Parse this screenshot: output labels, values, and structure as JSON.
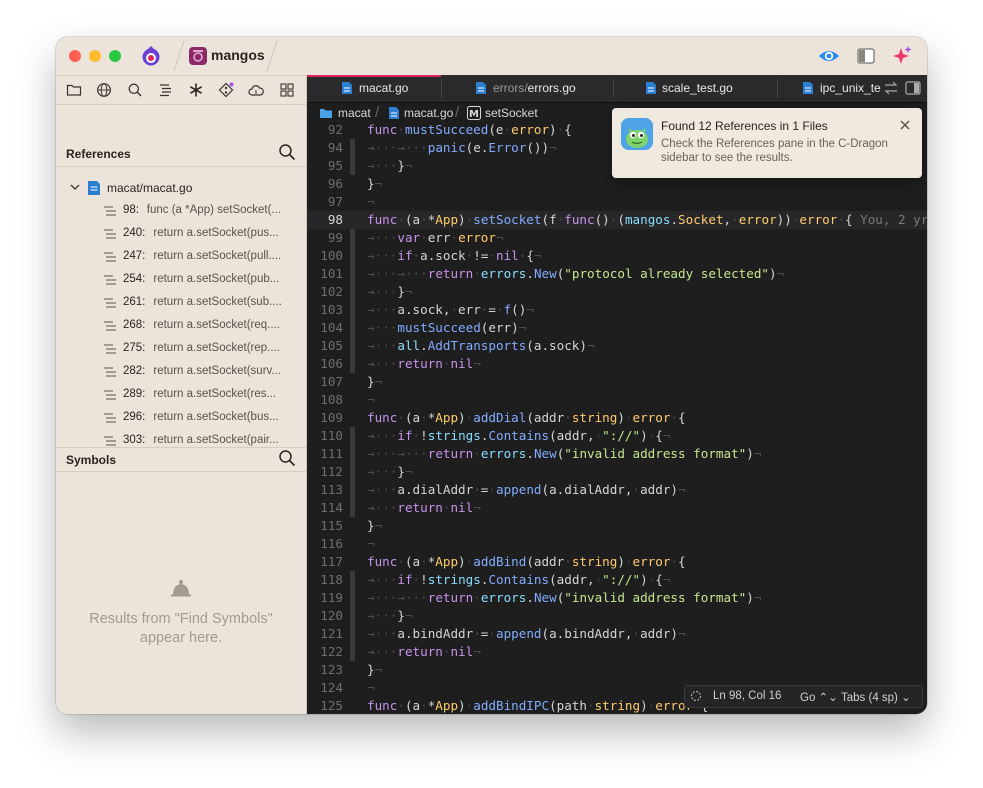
{
  "window": {
    "project_name": "mangos"
  },
  "sidebar": {
    "tools": [
      "folder-icon",
      "globe-icon",
      "search-icon",
      "list-icon",
      "asterisk-icon",
      "git-icon",
      "cloud-icon",
      "grid-icon"
    ],
    "references": {
      "title": "References",
      "file": "macat/macat.go",
      "items": [
        {
          "line": "98:",
          "text": "func (a *App) setSocket(..."
        },
        {
          "line": "240:",
          "text": "return a.setSocket(pus..."
        },
        {
          "line": "247:",
          "text": "return a.setSocket(pull...."
        },
        {
          "line": "254:",
          "text": "return a.setSocket(pub..."
        },
        {
          "line": "261:",
          "text": "return a.setSocket(sub...."
        },
        {
          "line": "268:",
          "text": "return a.setSocket(req...."
        },
        {
          "line": "275:",
          "text": "return a.setSocket(rep...."
        },
        {
          "line": "282:",
          "text": "return a.setSocket(surv..."
        },
        {
          "line": "289:",
          "text": "return a.setSocket(res..."
        },
        {
          "line": "296:",
          "text": "return a.setSocket(bus..."
        },
        {
          "line": "303:",
          "text": "return a.setSocket(pair..."
        }
      ]
    },
    "symbols": {
      "title": "Symbols",
      "empty_line1": "Results from \"Find Symbols\"",
      "empty_line2": "appear here."
    }
  },
  "tabs": [
    {
      "label": "macat.go",
      "active": true
    },
    {
      "label_dim": "errors/",
      "label": "errors.go",
      "active": false
    },
    {
      "label": "scale_test.go",
      "active": false
    },
    {
      "label": "ipc_unix_te",
      "active": false
    }
  ],
  "breadcrumb": {
    "folder": "macat",
    "file": "macat.go",
    "symbol": "setSocket"
  },
  "notification": {
    "title": "Found 12 References in 1 Files",
    "body": "Check the References pane in the C-Dragon sidebar to see the results."
  },
  "status_bar": {
    "position": "Ln 98, Col 16",
    "language": "Go",
    "indent": "Tabs (4 sp)"
  },
  "code": {
    "current_line": 98,
    "blame": "You, 2 yr...",
    "lines": [
      {
        "n": "92",
        "t": "func mustSucceed(e error) {"
      },
      {
        "n": "94",
        "t": "→   →   panic(e.Error())¬"
      },
      {
        "n": "95",
        "t": "→   }¬"
      },
      {
        "n": "96",
        "t": "}¬"
      },
      {
        "n": "97",
        "t": "¬"
      },
      {
        "n": "98",
        "t": "func (a *App) setSocket(f func() (mangos.Socket, error)) error {"
      },
      {
        "n": "99",
        "t": "→   var err error¬"
      },
      {
        "n": "100",
        "t": "→   if a.sock != nil {¬"
      },
      {
        "n": "101",
        "t": "→   →   return errors.New(\"protocol already selected\")¬"
      },
      {
        "n": "102",
        "t": "→   }¬"
      },
      {
        "n": "103",
        "t": "→   a.sock, err = f()¬"
      },
      {
        "n": "104",
        "t": "→   mustSucceed(err)¬"
      },
      {
        "n": "105",
        "t": "→   all.AddTransports(a.sock)¬"
      },
      {
        "n": "106",
        "t": "→   return nil¬"
      },
      {
        "n": "107",
        "t": "}¬"
      },
      {
        "n": "108",
        "t": "¬"
      },
      {
        "n": "109",
        "t": "func (a *App) addDial(addr string) error {"
      },
      {
        "n": "110",
        "t": "→   if !strings.Contains(addr, \"://\") {¬"
      },
      {
        "n": "111",
        "t": "→   →   return errors.New(\"invalid address format\")¬"
      },
      {
        "n": "112",
        "t": "→   }¬"
      },
      {
        "n": "113",
        "t": "→   a.dialAddr = append(a.dialAddr, addr)¬"
      },
      {
        "n": "114",
        "t": "→   return nil¬"
      },
      {
        "n": "115",
        "t": "}¬"
      },
      {
        "n": "116",
        "t": "¬"
      },
      {
        "n": "117",
        "t": "func (a *App) addBind(addr string) error {"
      },
      {
        "n": "118",
        "t": "→   if !strings.Contains(addr, \"://\") {¬"
      },
      {
        "n": "119",
        "t": "→   →   return errors.New(\"invalid address format\")¬"
      },
      {
        "n": "120",
        "t": "→   }¬"
      },
      {
        "n": "121",
        "t": "→   a.bindAddr = append(a.bindAddr, addr)¬"
      },
      {
        "n": "122",
        "t": "→   return nil¬"
      },
      {
        "n": "123",
        "t": "}¬"
      },
      {
        "n": "124",
        "t": "¬"
      },
      {
        "n": "125",
        "t": "func (a *App) addBindIPC(path string) error {"
      }
    ]
  }
}
